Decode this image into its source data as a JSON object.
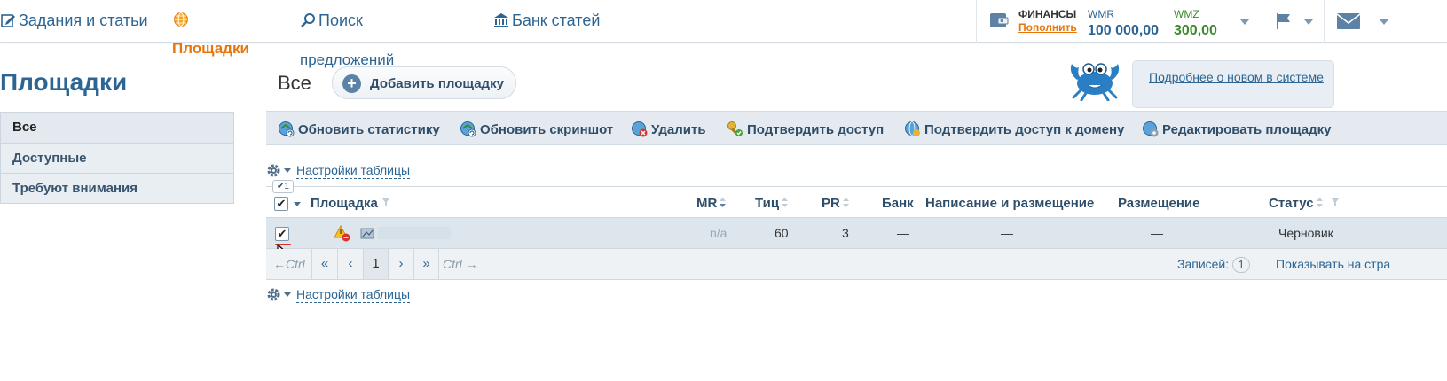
{
  "nav": {
    "tasks": "Задания и статьи",
    "platforms": "Площадки",
    "search": "Поиск",
    "search_sub": "предложений",
    "bank": "Банк статей"
  },
  "finance": {
    "title": "ФИНАНСЫ",
    "topup": "Пополнить",
    "wmr_label": "WMR",
    "wmr_value": "100 000,00",
    "wmz_label": "WMZ",
    "wmz_value": "300,00"
  },
  "page": {
    "title": "Площадки",
    "subtitle": "Все",
    "add_button": "Добавить площадку",
    "promo_link": "Подробнее о новом в системе"
  },
  "sidebar": {
    "items": [
      {
        "label": "Все"
      },
      {
        "label": "Доступные"
      },
      {
        "label": "Требуют внимания"
      }
    ]
  },
  "toolbar": {
    "refresh_stats": "Обновить статистику",
    "refresh_screenshot": "Обновить скриншот",
    "delete": "Удалить",
    "confirm_access": "Подтвердить доступ",
    "confirm_domain": "Подтвердить доступ к домену",
    "edit_platform": "Редактировать площадку"
  },
  "table_settings": "Настройки таблицы",
  "table": {
    "selected_badge": "✔1",
    "headers": {
      "platform": "Площадка",
      "mr": "MR",
      "tic": "Тиц",
      "pr": "PR",
      "bank": "Банк",
      "writing": "Написание и размещение",
      "placement": "Размещение",
      "status": "Статус"
    },
    "rows": [
      {
        "checked": "✔",
        "mr": "n/a",
        "tic": "60",
        "pr": "3",
        "bank": "—",
        "writing": "—",
        "placement": "—",
        "status": "Черновик"
      }
    ]
  },
  "pager": {
    "ctrl_left": "←Ctrl",
    "first": "«",
    "prev": "‹",
    "page": "1",
    "next": "›",
    "last": "»",
    "ctrl_right": "Ctrl →",
    "records_label": "Записей:",
    "records_count": "1",
    "show_per_page": "Показывать на стра"
  },
  "colors": {
    "link": "#2c6594",
    "accent_orange": "#e8750a",
    "wmr_blue": "#2c6594",
    "wmz_green": "#3a8a2a"
  }
}
